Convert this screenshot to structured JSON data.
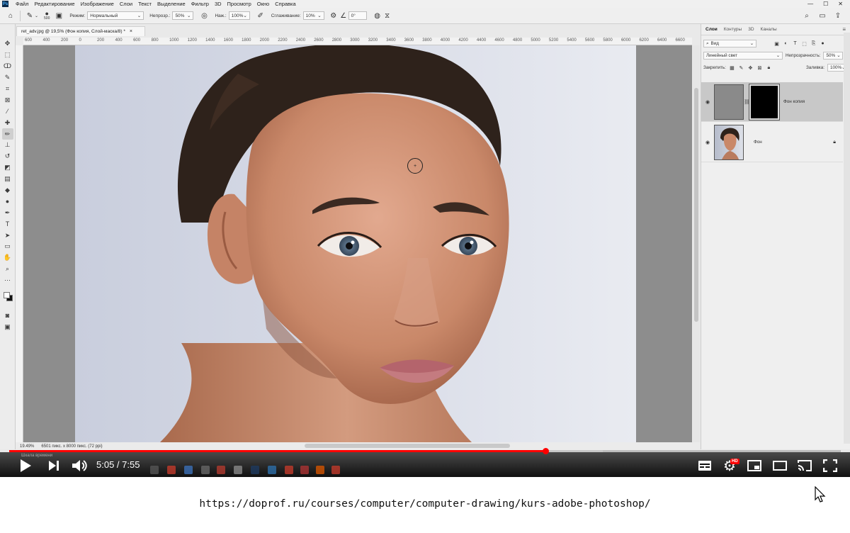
{
  "app": {
    "logo_text": "Ps",
    "menu": [
      "Файл",
      "Редактирование",
      "Изображение",
      "Слои",
      "Текст",
      "Выделение",
      "Фильтр",
      "3D",
      "Просмотр",
      "Окно",
      "Справка"
    ],
    "window_controls": [
      "—",
      "☐",
      "✕"
    ]
  },
  "options_bar": {
    "brush_size": "500",
    "mode_label": "Режим:",
    "mode_value": "Нормальный",
    "opacity_label": "Непрозр.:",
    "opacity_value": "50%",
    "pressure_label": "Наж.:",
    "pressure_value": "100%",
    "smoothing_label": "Сглаживание:",
    "smoothing_value": "10%",
    "angle_value": "0°"
  },
  "document": {
    "tab_title": "ret_adv.jpg @ 19,5% (Фон копия, Слой-маска/8) *",
    "ruler_marks": [
      "600",
      "400",
      "200",
      "0",
      "200",
      "400",
      "600",
      "800",
      "1000",
      "1200",
      "1400",
      "1600",
      "1800",
      "2000",
      "2200",
      "2400",
      "2600",
      "2800",
      "3000",
      "3200",
      "3400",
      "3600",
      "3800",
      "4000",
      "4200",
      "4400",
      "4600",
      "4800",
      "5000",
      "5200",
      "5400",
      "5600",
      "5800",
      "6000",
      "6200",
      "6400",
      "6600"
    ],
    "zoom": "19.49%",
    "doc_info": "6501 пикс. x 8000 пикс. (72 ppi)"
  },
  "layers_panel": {
    "tabs": [
      "Слои",
      "Контуры",
      "3D",
      "Каналы"
    ],
    "filter_label": "Вид",
    "blend_mode": "Линейный свет",
    "opacity_label": "Непрозрачность:",
    "opacity_value": "50%",
    "lock_label": "Закрепить:",
    "fill_label": "Заливка:",
    "fill_value": "100%",
    "layers": [
      {
        "name": "Фон копия",
        "selected": true
      },
      {
        "name": "Фон",
        "selected": false
      }
    ]
  },
  "timeline": {
    "label": "Шкала времени"
  },
  "player": {
    "current_time": "5:05",
    "duration": "7:55",
    "time_display": "5:05 / 7:55",
    "played_fraction": 0.645,
    "buffered_fraction": 0.714,
    "hd_badge": "HD",
    "accent_color": "#ff0000"
  },
  "caption": {
    "url": "https://doprof.ru/courses/computer/computer-drawing/kurs-adobe-photoshop/"
  }
}
